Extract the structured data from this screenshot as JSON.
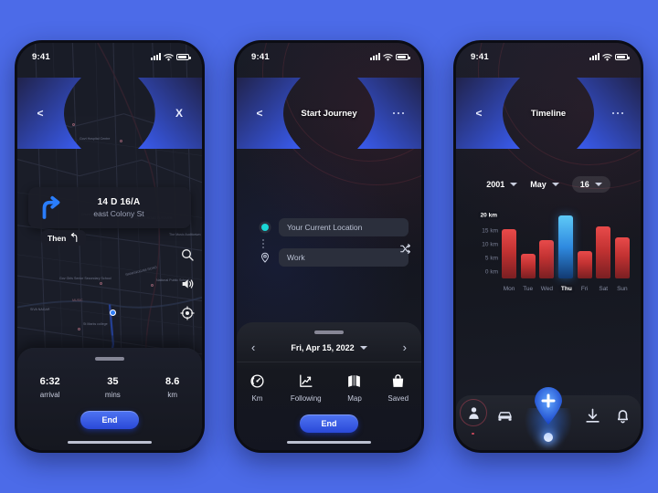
{
  "canvas": {
    "background": "#4c6be8"
  },
  "statusbar": {
    "time": "9:41",
    "signal_icon": "signal-bars-icon",
    "wifi_icon": "wifi-icon",
    "battery_icon": "battery-icon"
  },
  "phone1": {
    "header": {
      "back_label": "<",
      "close_label": "X",
      "title": ""
    },
    "nav_card": {
      "turn_icon": "turn-right-arrow-icon",
      "street_code": "14 D 16/A",
      "street_name": "east Colony St"
    },
    "then_chip": {
      "label": "Then",
      "icon": "u-turn-left-arrow-icon"
    },
    "map_fabs": [
      {
        "name": "search-icon"
      },
      {
        "name": "volume-icon"
      },
      {
        "name": "compass-icon"
      }
    ],
    "map_labels": [
      "Kumaran Hospital",
      "Govt Hospital Centre",
      "KAMARAJAR STREET",
      "Gov Girls Senior Secondary School",
      "National Public School",
      "RAMANUGAM ROAD",
      "SIVA NAGAR",
      "St Marks college",
      "Church Park",
      "OUTER ROAD FLYOVER",
      "The Music Auditorium",
      "MAIN ROAD",
      "Opal Diagnostics Centre",
      "Search Maps",
      "H Road",
      "MUSIC"
    ],
    "trip": [
      {
        "value": "6:32",
        "label": "arrival"
      },
      {
        "value": "35",
        "label": "mins"
      },
      {
        "value": "8.6",
        "label": "km"
      }
    ],
    "end_button": "End"
  },
  "phone2": {
    "header": {
      "back_label": "<",
      "title": "Start Journey",
      "menu_icon": "more-horizontal-icon"
    },
    "locations": {
      "origin": {
        "icon": "current-location-dot-icon",
        "value": "Your Current Location"
      },
      "destination": {
        "icon": "map-pin-icon",
        "value": "Work"
      },
      "swap_icon": "swap-shuffle-icon"
    },
    "date_picker": {
      "prev_label": "‹",
      "value": "Fri, Apr 15, 2022",
      "next_label": "›",
      "caret_icon": "chevron-down-icon"
    },
    "actions": [
      {
        "icon": "speedometer-icon",
        "label": "Km"
      },
      {
        "icon": "trend-chart-icon",
        "label": "Following"
      },
      {
        "icon": "map-icon",
        "label": "Map"
      },
      {
        "icon": "saved-bag-icon",
        "label": "Saved"
      }
    ],
    "end_button": "End"
  },
  "phone3": {
    "header": {
      "back_label": "<",
      "title": "Timeline",
      "menu_icon": "more-horizontal-icon"
    },
    "selectors": [
      {
        "name": "year-select",
        "value": "2001",
        "highlighted": false
      },
      {
        "name": "month-select",
        "value": "May",
        "highlighted": false
      },
      {
        "name": "day-select",
        "value": "16",
        "highlighted": true
      }
    ],
    "tabbar": [
      {
        "icon": "profile-location-icon",
        "name": "tab-profile"
      },
      {
        "icon": "car-icon",
        "name": "tab-vehicle"
      },
      {
        "icon": "add-plus-pin-icon",
        "name": "tab-add"
      },
      {
        "icon": "download-icon",
        "name": "tab-download"
      },
      {
        "icon": "bell-icon",
        "name": "tab-notifications"
      }
    ]
  },
  "chart_data": {
    "type": "bar",
    "title": "Timeline",
    "categories": [
      "Mon",
      "Tue",
      "Wed",
      "Thu",
      "Fri",
      "Sat",
      "Sun"
    ],
    "values": [
      18,
      9,
      14,
      23,
      10,
      19,
      15
    ],
    "unit": "km",
    "xlabel": "",
    "ylabel": "km",
    "ylim": [
      0,
      24
    ],
    "yticks": [
      0,
      5,
      10,
      15,
      20
    ],
    "ytick_labels": [
      "0 km",
      "5 km",
      "10 km",
      "15 km",
      "20 km"
    ],
    "highlight_index": 3,
    "highlight_tick": "20 km",
    "bar_color": "#d03434",
    "highlight_color": "#3f9ae8",
    "grid": false,
    "legend": false
  }
}
